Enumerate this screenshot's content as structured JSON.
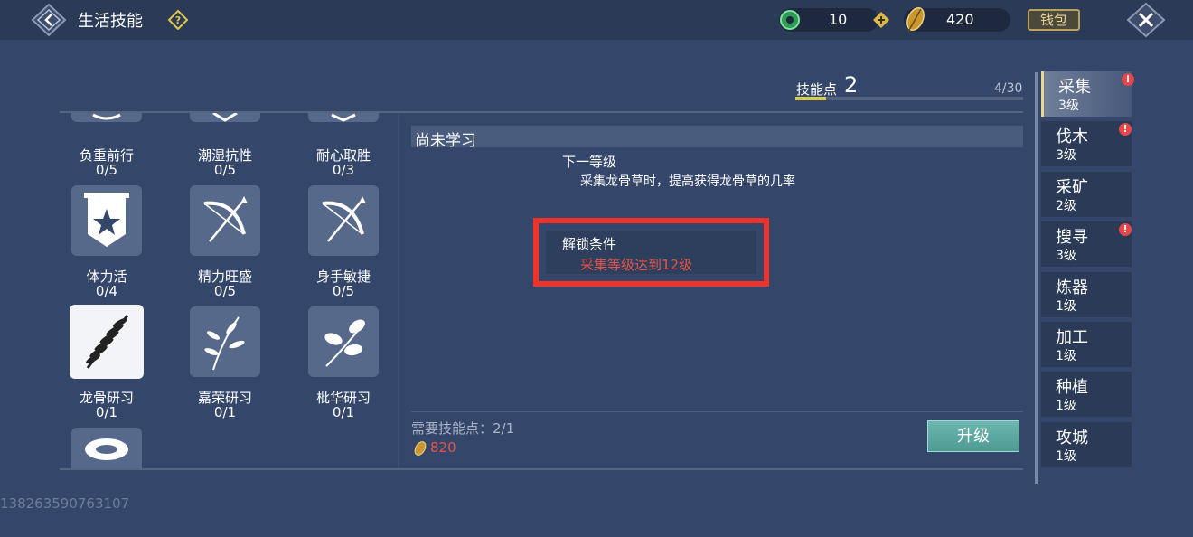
{
  "header": {
    "title": "生活技能",
    "help_icon": "question-diamond-icon",
    "jade_amount": "10",
    "feather_amount": "420",
    "wallet_label": "钱包"
  },
  "skill_points": {
    "label": "技能点",
    "value": "2",
    "count": "4/30",
    "progress": 0.1333
  },
  "skills": [
    {
      "name": "负重前行",
      "progress": "0/5",
      "icon": "partial-top-icon"
    },
    {
      "name": "潮湿抗性",
      "progress": "0/5",
      "icon": "partial-top-icon"
    },
    {
      "name": "耐心取胜",
      "progress": "0/3",
      "icon": "partial-top-icon"
    },
    {
      "name": "体力活",
      "progress": "0/4",
      "icon": "star-banner-icon"
    },
    {
      "name": "精力旺盛",
      "progress": "0/5",
      "icon": "bow-icon"
    },
    {
      "name": "身手敏捷",
      "progress": "0/5",
      "icon": "bow-icon"
    },
    {
      "name": "龙骨研习",
      "progress": "0/1",
      "icon": "fern-icon"
    },
    {
      "name": "嘉荣研习",
      "progress": "0/1",
      "icon": "herb-icon"
    },
    {
      "name": "枇华研习",
      "progress": "0/1",
      "icon": "leaf-icon"
    }
  ],
  "detail": {
    "title": "尚未学习",
    "next_level_label": "下一等级",
    "next_level_desc": "采集龙骨草时，提高获得龙骨草的几率",
    "unlock_label": "解锁条件",
    "unlock_condition": "采集等级达到12级",
    "required_label": "需要技能点：",
    "required_value": "2/1",
    "cost": "820",
    "upgrade_label": "升级"
  },
  "sidebar": {
    "items": [
      {
        "name": "采集",
        "level": "3级",
        "alert": true,
        "active": true
      },
      {
        "name": "伐木",
        "level": "3级",
        "alert": true,
        "active": false
      },
      {
        "name": "采矿",
        "level": "2级",
        "alert": false,
        "active": false
      },
      {
        "name": "搜寻",
        "level": "3级",
        "alert": true,
        "active": false
      },
      {
        "name": "炼器",
        "level": "1级",
        "alert": false,
        "active": false
      },
      {
        "name": "加工",
        "level": "1级",
        "alert": false,
        "active": false
      },
      {
        "name": "种植",
        "level": "1级",
        "alert": false,
        "active": false
      },
      {
        "name": "攻城",
        "level": "1级",
        "alert": false,
        "active": false
      }
    ]
  },
  "watermark": "138263590763107",
  "colors": {
    "background": "#34476b",
    "accent_red": "#e2544b",
    "highlight_box": "#f0322a",
    "upgrade_button": "#5fa8a1"
  }
}
